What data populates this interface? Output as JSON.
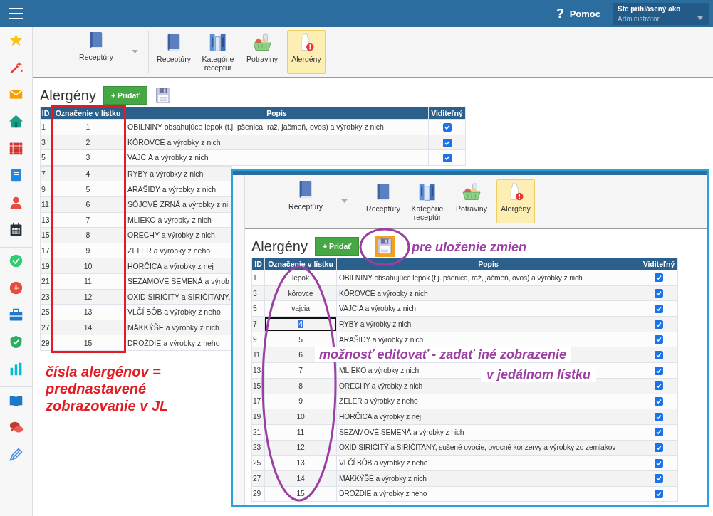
{
  "top_bar": {
    "help_icon": "?",
    "help": "Pomoc",
    "user_label": "Ste prihlásený ako",
    "user_name": "Administrátor"
  },
  "ribbon": {
    "dropdown": "Receptúry",
    "buttons": [
      {
        "label": "Receptúry",
        "kind": "book",
        "selected": false
      },
      {
        "label": "Kategórie receptúr",
        "kind": "books",
        "selected": false
      },
      {
        "label": "Potraviny",
        "kind": "basket",
        "selected": false
      },
      {
        "label": "Alergény",
        "kind": "milk",
        "selected": true
      }
    ]
  },
  "page": {
    "title": "Alergény",
    "add_button": "+ Pridať",
    "save_highlighted": false,
    "table": {
      "columns": [
        "ID",
        "Označenie v lístku",
        "Popis",
        "Viditeľný"
      ],
      "rows": [
        {
          "id": "1",
          "label": "1",
          "description": "OBILNINY obsahujúce lepok (t.j. pšenica, raž, jačmeň, ovos) a výrobky z nich",
          "visible": true
        },
        {
          "id": "3",
          "label": "2",
          "description": "KÔROVCE a výrobky z nich",
          "visible": true
        },
        {
          "id": "5",
          "label": "3",
          "description": "VAJCIA a výrobky z nich",
          "visible": true
        },
        {
          "id": "7",
          "label": "4",
          "description": "RYBY a výrobky z nich"
        },
        {
          "id": "9",
          "label": "5",
          "description": "ARAŠIDY a výrobky z nich"
        },
        {
          "id": "11",
          "label": "6",
          "description": "SÓJOVÉ ZRNÁ a výrobky z ni"
        },
        {
          "id": "13",
          "label": "7",
          "description": "MLIEKO a výrobky z nich"
        },
        {
          "id": "15",
          "label": "8",
          "description": "ORECHY a výrobky z nich"
        },
        {
          "id": "17",
          "label": "9",
          "description": "ZELER a výrobky z neho"
        },
        {
          "id": "19",
          "label": "10",
          "description": "HORČICA a výrobky z nej"
        },
        {
          "id": "21",
          "label": "11",
          "description": "SEZAMOVÉ SEMENÁ a výrob"
        },
        {
          "id": "23",
          "label": "12",
          "description": "OXID SIRIČITÝ a SIRIČITANY,"
        },
        {
          "id": "25",
          "label": "13",
          "description": "VLČÍ BÔB a výrobky z neho"
        },
        {
          "id": "27",
          "label": "14",
          "description": "MÄKKÝŠE a výrobky z nich"
        },
        {
          "id": "29",
          "label": "15",
          "description": "DROŽDIE a výrobky z neho"
        }
      ]
    }
  },
  "overlay": {
    "ribbon": {
      "dropdown": "Receptúry",
      "buttons": [
        {
          "label": "Receptúry",
          "kind": "book",
          "selected": false
        },
        {
          "label": "Kategórie receptúr",
          "kind": "books",
          "selected": false
        },
        {
          "label": "Potraviny",
          "kind": "basket",
          "selected": false
        },
        {
          "label": "Alergény",
          "kind": "milk",
          "selected": true
        }
      ]
    },
    "page": {
      "title": "Alergény",
      "add_button": "+ Pridať",
      "save_highlighted": true,
      "table": {
        "columns": [
          "ID",
          "Označenie v lístku",
          "Popis",
          "Viditeľný"
        ],
        "rows": [
          {
            "id": "1",
            "label": "lepok",
            "description": "OBILNINY obsahujúce lepok (t.j. pšenica, raž, jačmeň, ovos) a výrobky z nich",
            "visible": true,
            "editing": false
          },
          {
            "id": "3",
            "label": "kôrovce",
            "description": "KÔROVCE a výrobky z nich",
            "visible": true,
            "editing": false
          },
          {
            "id": "5",
            "label": "vajcia",
            "description": "VAJCIA a výrobky z nich",
            "visible": true,
            "editing": false
          },
          {
            "id": "7",
            "label": "4",
            "description": "RYBY a výrobky z nich",
            "visible": true,
            "editing": true
          },
          {
            "id": "9",
            "label": "5",
            "description": "ARAŠIDY a výrobky z nich",
            "visible": true,
            "editing": false
          },
          {
            "id": "11",
            "label": "6",
            "visible": true,
            "editing": false
          },
          {
            "id": "13",
            "label": "7",
            "description": "MLIEKO a výrobky z nich",
            "visible": true,
            "editing": false
          },
          {
            "id": "15",
            "label": "8",
            "description": "ORECHY a výrobky z nich",
            "visible": true,
            "editing": false
          },
          {
            "id": "17",
            "label": "9",
            "description": "ZELER a výrobky z neho",
            "visible": true,
            "editing": false
          },
          {
            "id": "19",
            "label": "10",
            "description": "HORČICA a výrobky z nej",
            "visible": true,
            "editing": false
          },
          {
            "id": "21",
            "label": "11",
            "description": "SEZAMOVÉ SEMENÁ a výrobky z nich",
            "visible": true,
            "editing": false
          },
          {
            "id": "23",
            "label": "12",
            "description": "OXID SIRIČITÝ a SIRIČITANY, sušené ovocie, ovocné konzervy a výrobky zo zemiakov",
            "visible": true,
            "editing": false
          },
          {
            "id": "25",
            "label": "13",
            "description": "VLČÍ BÔB a výrobky z neho",
            "visible": true,
            "editing": false
          },
          {
            "id": "27",
            "label": "14",
            "description": "MÄKKÝŠE a výrobky z nich",
            "visible": true,
            "editing": false
          },
          {
            "id": "29",
            "label": "15",
            "description": "DROŽDIE a výrobky z neho",
            "visible": true,
            "editing": false
          }
        ]
      }
    }
  },
  "annotations": {
    "columns_note": "čísla alergénov = prednastavené zobrazovanie v JL",
    "save_note": "pre uloženie zmien",
    "edit_note": [
      "možnosť editovať - zadať iné zobrazenie",
      "v jedálnom lístku"
    ]
  }
}
